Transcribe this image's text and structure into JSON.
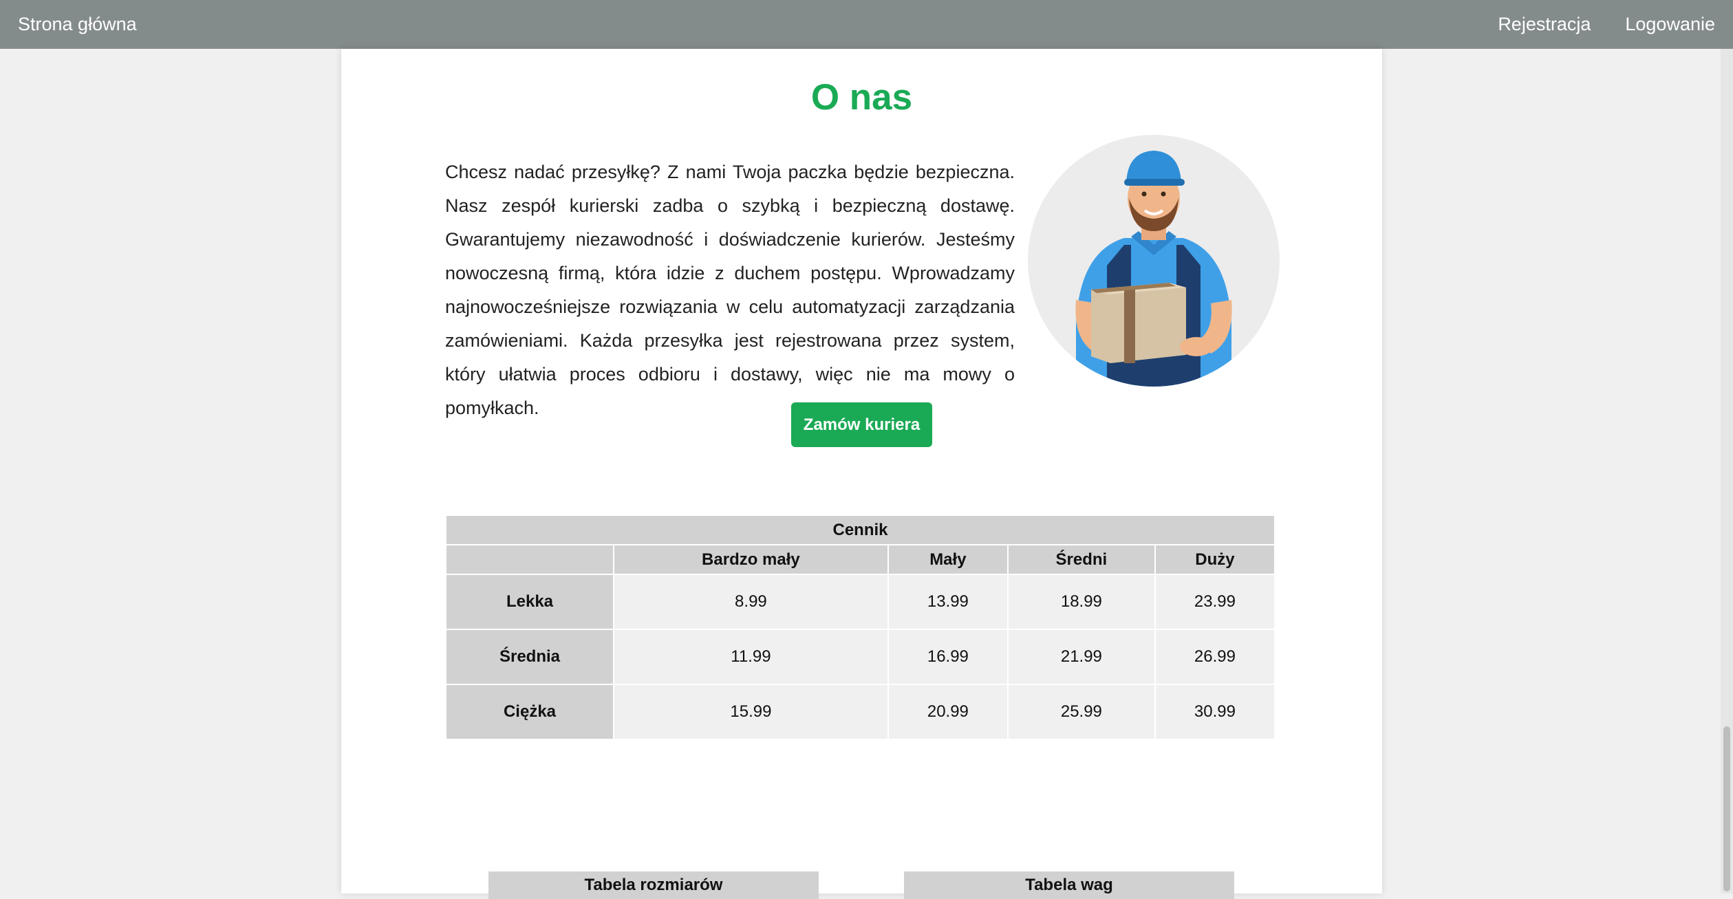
{
  "nav": {
    "home": "Strona główna",
    "register": "Rejestracja",
    "login": "Logowanie"
  },
  "about": {
    "title": "O nas",
    "text": "Chcesz nadać przesyłkę? Z nami Twoja paczka będzie bezpieczna. Nasz zespół kurierski zadba o szybką i bezpieczną dostawę. Gwarantujemy niezawodność i doświadczenie kurierów. Jesteśmy nowoczesną firmą, która idzie z duchem postępu. Wprowadzamy najnowocześniejsze rozwiązania w celu automatyzacji zarządzania zamówieniami. Każda przesyłka jest rejestrowana przez system, który ułatwia proces odbioru i dostawy, więc nie ma mowy o pomyłkach.",
    "button": "Zamów kuriera"
  },
  "price_table": {
    "caption": "Cennik",
    "columns": [
      "",
      "Bardzo mały",
      "Mały",
      "Średni",
      "Duży"
    ],
    "rows": [
      {
        "label": "Lekka",
        "values": [
          "8.99",
          "13.99",
          "18.99",
          "23.99"
        ]
      },
      {
        "label": "Średnia",
        "values": [
          "11.99",
          "16.99",
          "21.99",
          "26.99"
        ]
      },
      {
        "label": "Ciężka",
        "values": [
          "15.99",
          "20.99",
          "25.99",
          "30.99"
        ]
      }
    ]
  },
  "tables_below": {
    "sizes": "Tabela rozmiarów",
    "weights": "Tabela wag"
  },
  "colors": {
    "accent": "#1aaa55",
    "navbar": "#848b8b"
  }
}
